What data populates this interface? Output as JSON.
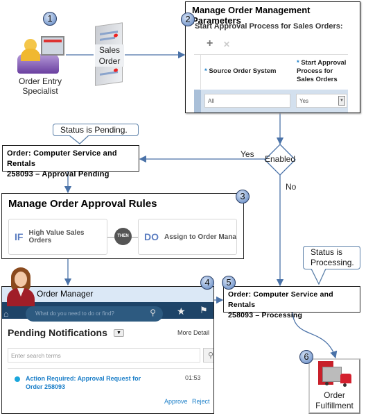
{
  "badges": [
    "1",
    "2",
    "3",
    "4",
    "5",
    "6"
  ],
  "actor1": {
    "label_line1": "Order Entry",
    "label_line2": "Specialist"
  },
  "document": {
    "label_line1": "Sales",
    "label_line2": "Order"
  },
  "parameters": {
    "title": "Manage Order Management Parameters",
    "subtitle": "Start Approval Process for Sales Orders:",
    "add_icon": "+",
    "delete_icon": "✕",
    "columns": [
      {
        "required": "*",
        "label": "Source Order System"
      },
      {
        "required": "*",
        "label": "Start Approval Process for Sales Orders"
      }
    ],
    "row": {
      "source": "All",
      "start_approval": "Yes"
    }
  },
  "decision": {
    "label": "Enabled",
    "yes": "Yes",
    "no": "No"
  },
  "pending": {
    "callout": "Status is Pending.",
    "line1": "Order: Computer Service and Rentals",
    "line2": "258093 – Approval Pending"
  },
  "rules": {
    "title": "Manage Order Approval Rules",
    "if_kw": "IF",
    "if_text": "High Value Sales Orders",
    "then": "THEN",
    "do_kw": "DO",
    "do_text": "Assign to Order Manager"
  },
  "manager": {
    "role": "Order Manager",
    "search_placeholder": "What do you need to do or find?",
    "heading": "Pending Notifications",
    "more": "More Detail",
    "filter_placeholder": "Enter search terms",
    "notification": {
      "line1": "Action Required: Approval Request for",
      "line2": "Order 258093",
      "time": "01:53"
    },
    "approve": "Approve",
    "reject": "Reject"
  },
  "processing": {
    "callout_line1": "Status is",
    "callout_line2": "Processing.",
    "line1": "Order: Computer Service and Rentals",
    "line2": "258093 – Processing"
  },
  "fulfillment": {
    "line1": "Order",
    "line2": "Fulfillment"
  },
  "colors": {
    "line": "#4a72a8",
    "link": "#1a7ec8",
    "navy": "#1e4468",
    "header_bg": "#dbe8f6"
  }
}
